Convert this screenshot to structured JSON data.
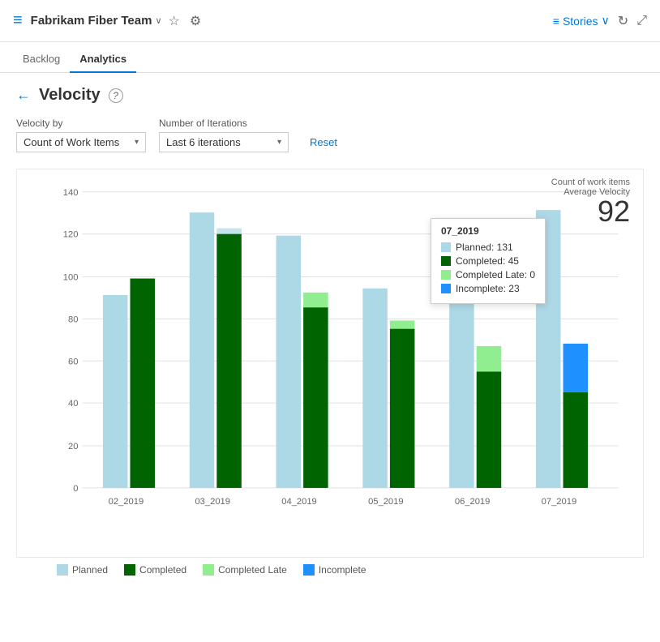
{
  "header": {
    "icon": "≡",
    "team_name": "Fabrikam Fiber Team",
    "chevron": "∨",
    "star_icon": "☆",
    "people_icon": "👥",
    "stories_label": "Stories",
    "stories_chevron": "∨",
    "refresh_icon": "↻",
    "expand_icon": "⤢"
  },
  "nav": {
    "tabs": [
      {
        "label": "Backlog",
        "active": false
      },
      {
        "label": "Analytics",
        "active": true
      }
    ]
  },
  "page": {
    "back_icon": "←",
    "title": "Velocity",
    "help_icon": "?"
  },
  "filters": {
    "velocity_by_label": "Velocity by",
    "velocity_by_value": "Count of Work Items",
    "iterations_label": "Number of Iterations",
    "iterations_value": "Last 6 iterations",
    "reset_label": "Reset"
  },
  "chart": {
    "summary_label1": "Count of work items",
    "summary_label2": "Average Velocity",
    "summary_value": "92",
    "y_axis_labels": [
      "0",
      "20",
      "40",
      "60",
      "80",
      "100",
      "120",
      "140"
    ],
    "x_axis_labels": [
      "02_2019",
      "03_2019",
      "04_2019",
      "05_2019",
      "06_2019",
      "07_2019"
    ],
    "bars": [
      {
        "sprint": "02_2019",
        "planned": 91,
        "completed": 99,
        "completed_late": 0,
        "incomplete": 0
      },
      {
        "sprint": "03_2019",
        "planned": 130,
        "completed": 120,
        "completed_late": 0,
        "incomplete": 0
      },
      {
        "sprint": "04_2019",
        "planned": 119,
        "completed": 85,
        "completed_late": 7,
        "incomplete": 0
      },
      {
        "sprint": "05_2019",
        "planned": 94,
        "completed": 75,
        "completed_late": 4,
        "incomplete": 0
      },
      {
        "sprint": "06_2019",
        "planned": 91,
        "completed": 55,
        "completed_late": 12,
        "incomplete": 0
      },
      {
        "sprint": "07_2019",
        "planned": 131,
        "completed": 45,
        "completed_late": 0,
        "incomplete": 23
      }
    ],
    "tooltip": {
      "title": "07_2019",
      "rows": [
        {
          "color": "#add8e6",
          "label": "Planned: 131"
        },
        {
          "color": "#006400",
          "label": "Completed: 45"
        },
        {
          "color": "#90ee90",
          "label": "Completed Late: 0"
        },
        {
          "color": "#1e90ff",
          "label": "Incomplete: 23"
        }
      ]
    },
    "legend": [
      {
        "color": "#add8e6",
        "label": "Planned"
      },
      {
        "color": "#006400",
        "label": "Completed"
      },
      {
        "color": "#90ee90",
        "label": "Completed Late"
      },
      {
        "color": "#1e90ff",
        "label": "Incomplete"
      }
    ]
  }
}
